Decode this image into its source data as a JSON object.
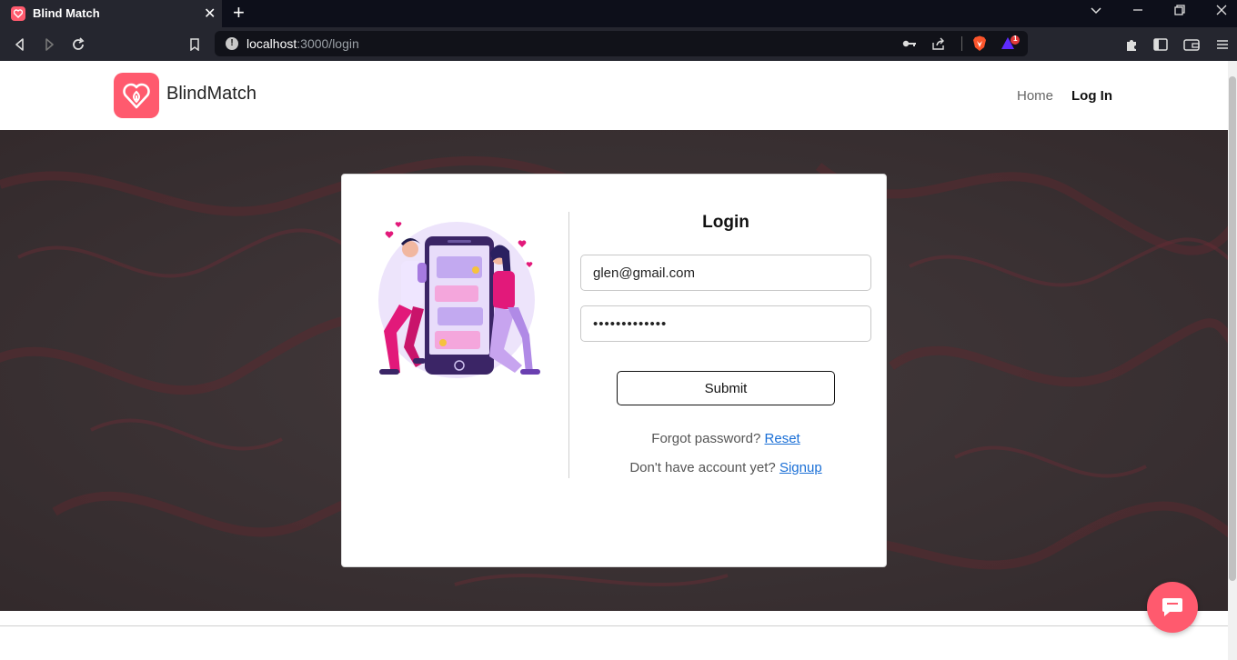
{
  "browser": {
    "tab_title": "Blind Match",
    "tab_close": "✕",
    "new_tab": "+",
    "url_host": "localhost",
    "url_path": ":3000/login",
    "brave_badge": "1"
  },
  "navbar": {
    "brand": "BlindMatch",
    "links": [
      {
        "label": "Home"
      },
      {
        "label": "Log In"
      }
    ]
  },
  "login": {
    "title": "Login",
    "email_value": "glen@gmail.com",
    "password_value": "•••••••••••••",
    "submit_label": "Submit",
    "forgot_text": "Forgot password?",
    "reset_link": "Reset",
    "signup_text": "Don't have account yet?",
    "signup_link": "Signup"
  },
  "colors": {
    "brand": "#ff5a6e",
    "link": "#1a6fd6",
    "hero_bg": "#3b3133"
  }
}
